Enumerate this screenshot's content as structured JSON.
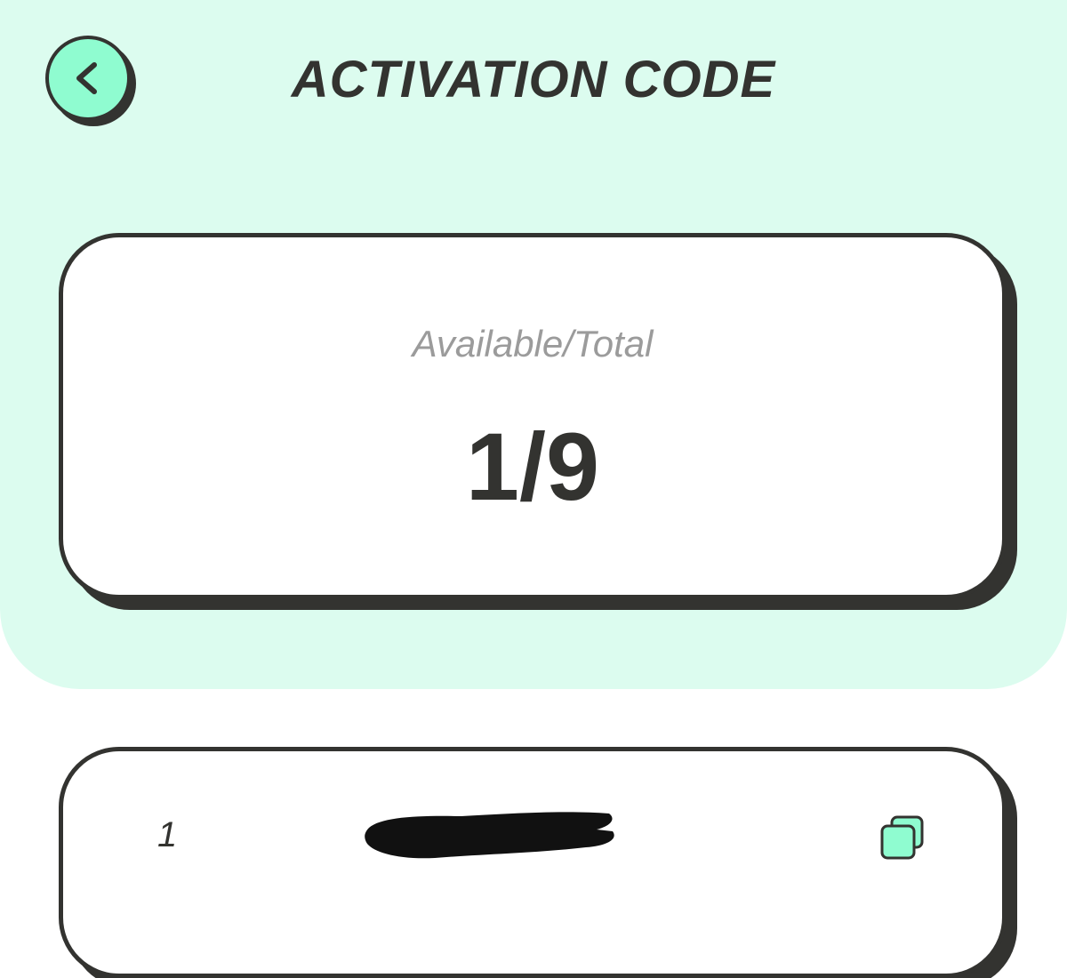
{
  "header": {
    "title": "ACTIVATION CODE",
    "back_icon": "chevron-left-icon"
  },
  "summary": {
    "label": "Available/Total",
    "value": "1/9",
    "available": 1,
    "total": 9
  },
  "codes": [
    {
      "index": "1",
      "code_redacted": true,
      "copy_icon": "copy-icon"
    }
  ],
  "colors": {
    "panel_bg": "#dcfcef",
    "accent": "#8ffcd0",
    "outline": "#333330",
    "label_gray": "#9b9b9b"
  }
}
